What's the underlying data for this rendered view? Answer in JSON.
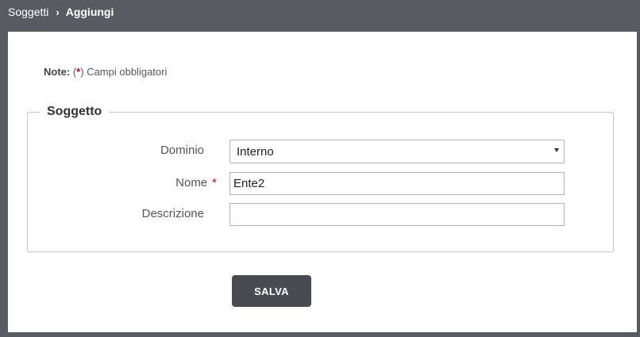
{
  "breadcrumb": {
    "parent": "Soggetti",
    "separator": "›",
    "current": "Aggiungi"
  },
  "note": {
    "label": "Note:",
    "open": " (",
    "star": "*",
    "close": ")",
    "text": " Campi obbligatori"
  },
  "section": {
    "legend": "Soggetto"
  },
  "form": {
    "dominio": {
      "label": "Dominio",
      "value": "Interno"
    },
    "nome": {
      "label": "Nome",
      "required_mark": "*",
      "value": "Ente2"
    },
    "descrizione": {
      "label": "Descrizione",
      "value": ""
    }
  },
  "actions": {
    "save_label": "SALVA"
  },
  "colors": {
    "background": "#5a5a63",
    "required": "#d0021b",
    "button": "#4a4a52"
  }
}
